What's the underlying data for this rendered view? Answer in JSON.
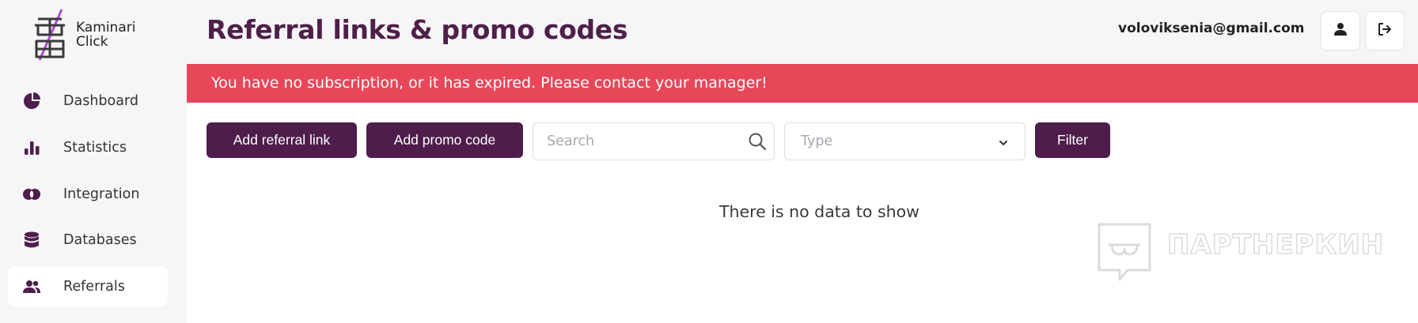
{
  "brand": {
    "line1": "Kaminari",
    "line2": "Click"
  },
  "sidebar": {
    "items": [
      {
        "label": "Dashboard",
        "icon": "pie-chart-icon",
        "active": false
      },
      {
        "label": "Statistics",
        "icon": "bar-chart-icon",
        "active": false
      },
      {
        "label": "Integration",
        "icon": "link-icon",
        "active": false
      },
      {
        "label": "Databases",
        "icon": "database-icon",
        "active": false
      },
      {
        "label": "Referrals",
        "icon": "users-icon",
        "active": true
      }
    ]
  },
  "header": {
    "title": "Referral links & promo codes",
    "user_email": "voloviksenia@gmail.com",
    "profile_icon": "user-icon",
    "logout_icon": "logout-icon"
  },
  "alert": {
    "text": "You have no subscription, or it has expired. Please contact your manager!"
  },
  "toolbar": {
    "add_referral_label": "Add referral link",
    "add_promo_label": "Add promo code",
    "search_placeholder": "Search",
    "type_placeholder": "Type",
    "filter_label": "Filter"
  },
  "content": {
    "empty_text": "There is no data to show"
  },
  "watermark": {
    "text": "ПАРТНЕРКИН"
  },
  "colors": {
    "brand": "#4e1d4b",
    "alert": "#e8475a",
    "sidebar_bg": "#f6f6f8"
  }
}
